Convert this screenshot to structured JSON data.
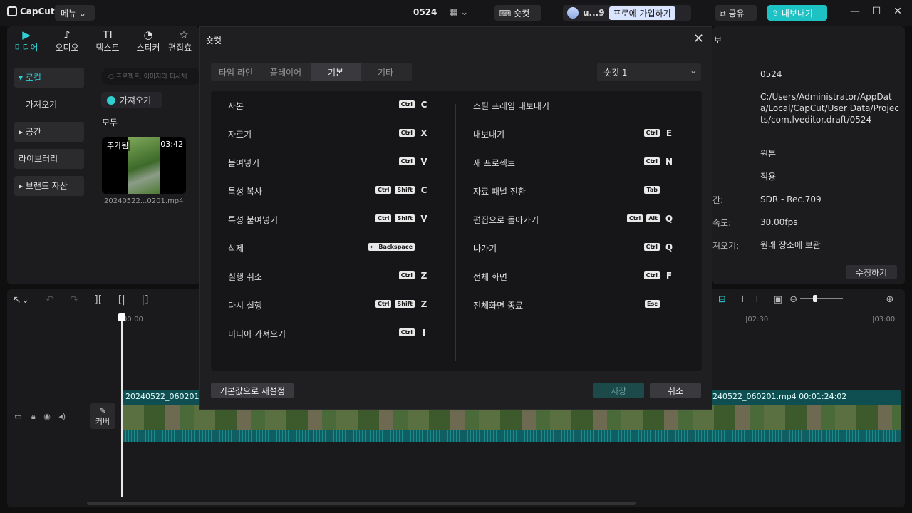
{
  "app": {
    "logo": "CapCut",
    "menu": "메뉴",
    "project": "0524",
    "shortcut_btn": "숏컷",
    "user": "u...9",
    "pro": "프로에 가입하기",
    "share": "공유",
    "export": "내보내기"
  },
  "media_tabs": [
    {
      "label": "미디어"
    },
    {
      "label": "오디오"
    },
    {
      "label": "텍스트"
    },
    {
      "label": "스티커"
    },
    {
      "label": "편집효"
    }
  ],
  "sidenav": {
    "local": "▾ 로컬",
    "import": "가져오기",
    "space": "▸ 공간",
    "library": "라이브러리",
    "brand": "▸ 브랜드 자산"
  },
  "search_placeholder": "프로젝트, 이미지의 피사체...",
  "import_btn": "가져오기",
  "all_label": "모두",
  "media_item": {
    "added": "추가됨",
    "duration": "03:42",
    "filename": "20240522...0201.mp4"
  },
  "right_panel": {
    "header": "보",
    "name": "0524",
    "path": "C:/Users/Administrator/AppData/Local/CapCut/User Data/Projects/com.lveditor.draft/0524",
    "ratio": "원본",
    "apply": "적용",
    "color_label": "간:",
    "color": "SDR - Rec.709",
    "fps_label": "속도:",
    "fps": "30.00fps",
    "import_label": "져오기:",
    "import_mode": "원래 장소에 보관",
    "edit_btn": "수정하기"
  },
  "timeline": {
    "t0": "00:00",
    "t1": "|02:30",
    "t2": "|03:00",
    "clip1": "20240522_060201.m",
    "clip2": "240522_060201.mp4  00:01:24:02",
    "cover": "커버"
  },
  "modal": {
    "title": "숏컷",
    "tabs": [
      "타임 라인",
      "플레이어",
      "기본",
      "기타"
    ],
    "active_tab": "기본",
    "preset": "숏컷 1",
    "left": [
      {
        "label": "사본",
        "keys": [
          "Ctrl"
        ],
        "letter": "C"
      },
      {
        "label": "자르기",
        "keys": [
          "Ctrl"
        ],
        "letter": "X"
      },
      {
        "label": "붙여넣기",
        "keys": [
          "Ctrl"
        ],
        "letter": "V"
      },
      {
        "label": "특성 복사",
        "keys": [
          "Ctrl",
          "Shift"
        ],
        "letter": "C"
      },
      {
        "label": "특성 붙여넣기",
        "keys": [
          "Ctrl",
          "Shift"
        ],
        "letter": "V"
      },
      {
        "label": "삭제",
        "keys": [
          "⟵Backspace"
        ],
        "letter": ""
      },
      {
        "label": "실행 취소",
        "keys": [
          "Ctrl"
        ],
        "letter": "Z"
      },
      {
        "label": "다시 실행",
        "keys": [
          "Ctrl",
          "Shift"
        ],
        "letter": "Z"
      },
      {
        "label": "미디어 가져오기",
        "keys": [
          "Ctrl"
        ],
        "letter": "I"
      }
    ],
    "right": [
      {
        "label": "스틸 프레임 내보내기",
        "keys": [],
        "letter": ""
      },
      {
        "label": "내보내기",
        "keys": [
          "Ctrl"
        ],
        "letter": "E"
      },
      {
        "label": "새 프로젝트",
        "keys": [
          "Ctrl"
        ],
        "letter": "N"
      },
      {
        "label": "자료 패널 전환",
        "keys": [
          "Tab"
        ],
        "letter": ""
      },
      {
        "label": "편집으로 돌아가기",
        "keys": [
          "Ctrl",
          "Alt"
        ],
        "letter": "Q"
      },
      {
        "label": "나가기",
        "keys": [
          "Ctrl"
        ],
        "letter": "Q"
      },
      {
        "label": "전체 화면",
        "keys": [
          "Ctrl"
        ],
        "letter": "F"
      },
      {
        "label": "전체화면 종료",
        "keys": [
          "Esc"
        ],
        "letter": ""
      }
    ],
    "reset": "기본값으로 재설정",
    "save": "저장",
    "cancel": "취소"
  }
}
